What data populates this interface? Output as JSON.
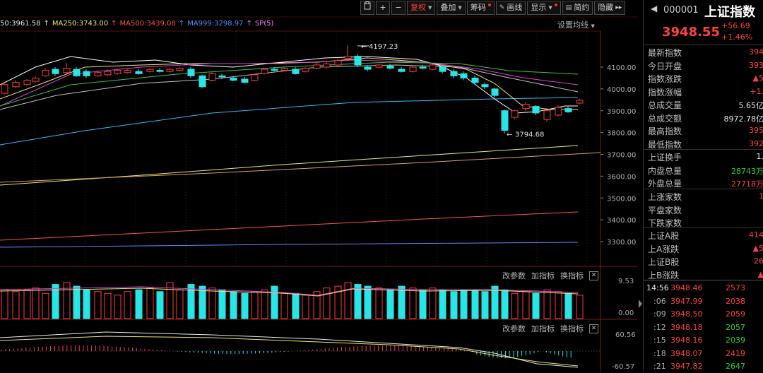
{
  "toolbar": {
    "items": [
      {
        "name": "copy",
        "label": "",
        "icon": "clipboard-icon"
      },
      {
        "name": "zoom-in",
        "label": "+",
        "icon": "plus-icon"
      },
      {
        "name": "zoom-out",
        "label": "−",
        "icon": "minus-icon"
      },
      {
        "name": "fuquan",
        "label": "复权",
        "dropdown": true,
        "active": true
      },
      {
        "name": "diejia",
        "label": "叠加",
        "dropdown": true
      },
      {
        "name": "chouma",
        "label": "筹码",
        "dot": true
      },
      {
        "name": "huaxian",
        "label": "画线",
        "icon": "pen-icon"
      },
      {
        "name": "xianshi",
        "label": "显示",
        "dropdown": true,
        "dot": true
      },
      {
        "name": "jianyue",
        "label": "简约",
        "icon": "list-icon"
      },
      {
        "name": "yincang",
        "label": "隐藏",
        "icon": "double-arrow-icon"
      }
    ]
  },
  "ma_row": [
    {
      "label": "50:3961.58",
      "color": "#e8e8e8"
    },
    {
      "label": "MA250:3743.00",
      "color": "#e8e870"
    },
    {
      "label": "MA500:3439.08",
      "color": "#ff5050"
    },
    {
      "label": "MA999:3298.97",
      "color": "#5a8cff"
    },
    {
      "label": "SP(5)",
      "color": "#ff80ff"
    }
  ],
  "settings_ma": "设置均线",
  "price_axis": [
    "4100.00",
    "4000.00",
    "3900.00",
    "3800.00",
    "3700.00",
    "3600.00",
    "3500.00",
    "3400.00",
    "3300.00"
  ],
  "price_labels": {
    "high": "4197.23",
    "low": "3794.68"
  },
  "volume_panel": {
    "buttons": [
      "改参数",
      "加指标",
      "换指标"
    ],
    "top": "9.53",
    "bottom": "0.00"
  },
  "macd_panel": {
    "buttons": [
      "改参数",
      "加指标",
      "换指标"
    ],
    "top": "60.56",
    "bottom": "-60.57"
  },
  "quote": {
    "code": "000001",
    "name": "上证指数",
    "price": "3948.55",
    "change": "+56.69",
    "pct": "+1.46%"
  },
  "fields_a": [
    {
      "k": "最新指数",
      "v": "394",
      "c": "red"
    },
    {
      "k": "今日开盘",
      "v": "393",
      "c": "red"
    },
    {
      "k": "指数涨跌",
      "v": "▲5",
      "c": "red"
    },
    {
      "k": "指数涨幅",
      "v": "+1.",
      "c": "red"
    },
    {
      "k": "总成交量",
      "v": "5.65亿",
      "c": "white"
    },
    {
      "k": "总成交额",
      "v": "8972.78亿",
      "c": "white"
    },
    {
      "k": "最高指数",
      "v": "395",
      "c": "red"
    },
    {
      "k": "最低指数",
      "v": "392",
      "c": "red"
    }
  ],
  "fields_b": [
    {
      "k": "上证换手",
      "v": "1.",
      "c": "white"
    },
    {
      "k": "内盘总量",
      "v": "28743万",
      "c": "green"
    },
    {
      "k": "外盘总量",
      "v": "27718万",
      "c": "red"
    }
  ],
  "fields_c": [
    {
      "k": "上涨家数",
      "v": "1",
      "c": "red"
    },
    {
      "k": "平盘家数",
      "v": "",
      "c": "white"
    },
    {
      "k": "下跌家数",
      "v": "",
      "c": "green"
    }
  ],
  "fields_d": [
    {
      "k": "上证A股",
      "v": "414",
      "c": "red"
    },
    {
      "k": "上A涨跌",
      "v": "▲5",
      "c": "red"
    },
    {
      "k": "上证B股",
      "v": "26",
      "c": "red"
    },
    {
      "k": "上B涨跌",
      "v": "▲",
      "c": "red"
    }
  ],
  "ticks": [
    {
      "t": "14:56",
      "p": "3948.46",
      "q": "2573",
      "c": "red"
    },
    {
      "t": ":06",
      "p": "3947.99",
      "q": "2038",
      "c": "red"
    },
    {
      "t": ":09",
      "p": "3948.50",
      "q": "2059",
      "c": "red"
    },
    {
      "t": ":12",
      "p": "3948.18",
      "q": "2057",
      "c": "green"
    },
    {
      "t": ":15",
      "p": "3948.16",
      "q": "2039",
      "c": "green"
    },
    {
      "t": ":18",
      "p": "3948.07",
      "q": "2419",
      "c": "red"
    },
    {
      "t": ":21",
      "p": "3947.82",
      "q": "2647",
      "c": "green"
    }
  ],
  "colors": {
    "up": "#ff3b3b",
    "down": "#27e6e6",
    "axis": "#9a9a9a"
  }
}
